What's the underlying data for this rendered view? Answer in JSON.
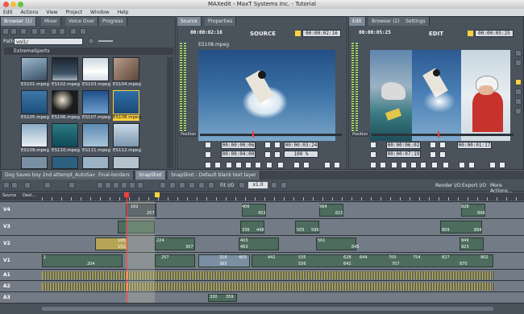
{
  "window": {
    "title": "MAXedit - MaxT Systems Inc. - Tutorial"
  },
  "menu": [
    "Edit",
    "Actions",
    "View",
    "Project",
    "Window",
    "Help"
  ],
  "browser": {
    "tabs": [
      "Browser (1)",
      "Mixer",
      "Voice Over",
      "Progress"
    ],
    "path_label": "Path",
    "path_value": "vol1/",
    "folder": "ExtremeSports",
    "thumbs": [
      "ES101.mpeg",
      "ES102.mpeg",
      "ES103.mpeg",
      "ES104.mpeg",
      "ES105.mpeg",
      "ES106.mpeg",
      "ES107.mpeg",
      "ES108.mpeg",
      "ES109.mpeg",
      "ES110.mpeg",
      "ES111.mpeg",
      "ES112.mpeg"
    ]
  },
  "source": {
    "tabs": [
      "Source",
      "Properties"
    ],
    "tc_left": "00:00:02:16",
    "label": "SOURCE",
    "tc_right": "00:00:02:16",
    "clip": "ES108.mpeg",
    "position": "Position",
    "in": "00:00:00:06",
    "out": "00:00:03:24",
    "dur": "00:00:04:00",
    "zoom": "100 %"
  },
  "edit": {
    "tabs": [
      "Edit",
      "Browser (2)",
      "Settings"
    ],
    "tc_left": "00:00:05:25",
    "label": "EDIT",
    "tc_right": "00:00:05:25",
    "position": "Position",
    "in": "00:00:06:02",
    "out": "00:00:01:17",
    "dur": "00:00:07:19"
  },
  "timeline": {
    "tabs": [
      "Dog Saves boy 2nd attempt_AutoSave",
      "Final-borders",
      "SnapShot",
      "SnapShot - Default blank text layer"
    ],
    "fit": "Fit I/O",
    "zoom": "x1.0",
    "render": "Render I/O",
    "export": "Export I/O",
    "more": "More Actions...",
    "source_label": "Source",
    "dest_label": "Dest...",
    "tracks": [
      "V4",
      "V3",
      "V2",
      "V1",
      "A1",
      "A2",
      "A3"
    ],
    "v4_nums": [
      "162",
      "257",
      "406",
      "453",
      "564",
      "615",
      "828",
      "899"
    ],
    "v3_nums": [
      "336",
      "448",
      "505",
      "599",
      "809",
      "894"
    ],
    "v2_nums": [
      "105",
      "151",
      "224",
      "307",
      "403",
      "463",
      "561",
      "645",
      "849",
      "923"
    ],
    "v1_nums": [
      "1",
      "204",
      "257",
      "318",
      "365",
      "403",
      "442",
      "535",
      "556",
      "628",
      "642",
      "644",
      "700",
      "707",
      "754",
      "827",
      "870",
      "902"
    ],
    "a_nums": [
      "330",
      "359"
    ]
  },
  "colors": {
    "accent": "#ffd23e",
    "clip_green": "#4d6b5e",
    "wave": "#d9c96a"
  }
}
